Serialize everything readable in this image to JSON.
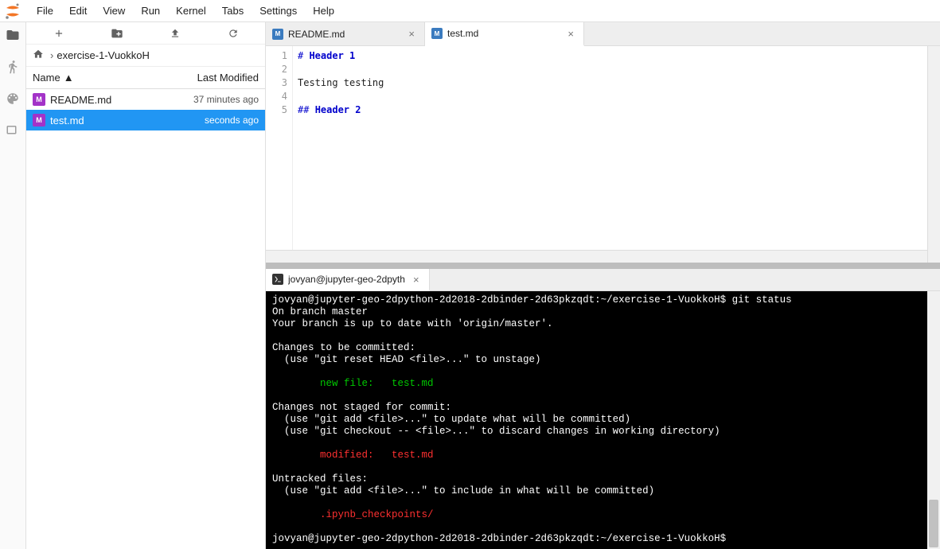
{
  "menu": {
    "items": [
      "File",
      "Edit",
      "View",
      "Run",
      "Kernel",
      "Tabs",
      "Settings",
      "Help"
    ]
  },
  "breadcrumb": {
    "path": "exercise-1-VuokkoH"
  },
  "filebrowser": {
    "columns": {
      "name": "Name",
      "modified": "Last Modified"
    },
    "files": [
      {
        "name": "README.md",
        "modified": "37 minutes ago",
        "icon": "M",
        "selected": false
      },
      {
        "name": "test.md",
        "modified": "seconds ago",
        "icon": "M",
        "selected": true
      }
    ]
  },
  "editorTabs": [
    {
      "label": "README.md",
      "icon": "md",
      "active": false
    },
    {
      "label": "test.md",
      "icon": "md",
      "active": true
    }
  ],
  "editor": {
    "lines": [
      {
        "n": 1,
        "type": "h1",
        "mark": "# ",
        "text": "Header 1"
      },
      {
        "n": 2,
        "type": "blank"
      },
      {
        "n": 3,
        "type": "text",
        "text": "Testing testing"
      },
      {
        "n": 4,
        "type": "blank"
      },
      {
        "n": 5,
        "type": "h2",
        "mark": "## ",
        "text": "Header 2"
      }
    ]
  },
  "terminalTab": {
    "label": "jovyan@jupyter-geo-2dpyth"
  },
  "terminal": {
    "prompt": "jovyan@jupyter-geo-2dpython-2d2018-2dbinder-2d63pkzqdt:~/exercise-1-VuokkoH$",
    "cmd": "git status",
    "lines": [
      "On branch master",
      "Your branch is up to date with 'origin/master'.",
      "",
      "Changes to be committed:",
      "  (use \"git reset HEAD <file>...\" to unstage)",
      "",
      {
        "cls": "t-green",
        "text": "        new file:   test.md"
      },
      "",
      "Changes not staged for commit:",
      "  (use \"git add <file>...\" to update what will be committed)",
      "  (use \"git checkout -- <file>...\" to discard changes in working directory)",
      "",
      {
        "cls": "t-red",
        "text": "        modified:   test.md"
      },
      "",
      "Untracked files:",
      "  (use \"git add <file>...\" to include in what will be committed)",
      "",
      {
        "cls": "t-red",
        "text": "        .ipynb_checkpoints/"
      },
      ""
    ]
  }
}
